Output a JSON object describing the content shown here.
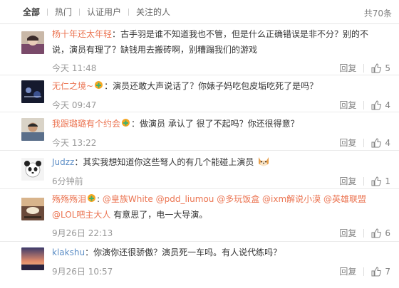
{
  "tabs": [
    "全部",
    "热门",
    "认证用户",
    "关注的人"
  ],
  "total": "共70条",
  "reply_label": "回复",
  "comments": [
    {
      "nick": "杨十年还太年轻",
      "text_line1": "：古手羽是谁不知道我也不管，但是什么正确错误是非不分？别的不",
      "text_line2": "说，演员有理了？缺钱用去搬砖啊，别糟蹋我们的游戏",
      "time": "今天 11:48",
      "likes": "5"
    },
    {
      "nick": "无仁之境~",
      "text": "：演员还敢大声说话了？你婊子妈吃包皮垢吃死了是吗？",
      "time": "今天 09:47",
      "likes": "4"
    },
    {
      "nick": "我跟璐璐有个约会",
      "text": "：做演员 承认了 很了不起吗？你还很得意？",
      "time": "今天 13:22",
      "likes": "4"
    },
    {
      "nick": "Judzz",
      "text": "：其实我想知道你这些弩人的有几个能碰上演员",
      "time": "6分钟前",
      "likes": "1"
    },
    {
      "nick": "殇殇殇泪",
      "mentions_line1": [
        "@皇族White",
        "@pdd_liumou",
        "@多玩饭盒",
        "@ixm解说小漠",
        "@英雄联盟"
      ],
      "mention_line2": "@LOL吧主大人",
      "text_line2": " 有意思了，电一大导演。",
      "time": "9月26日 22:13",
      "likes": "6"
    },
    {
      "nick": "klakshu",
      "text": "：你演你还很骄傲？演员死一车吗。有人说代练吗？",
      "time": "9月26日 10:57",
      "likes": "7"
    }
  ]
}
